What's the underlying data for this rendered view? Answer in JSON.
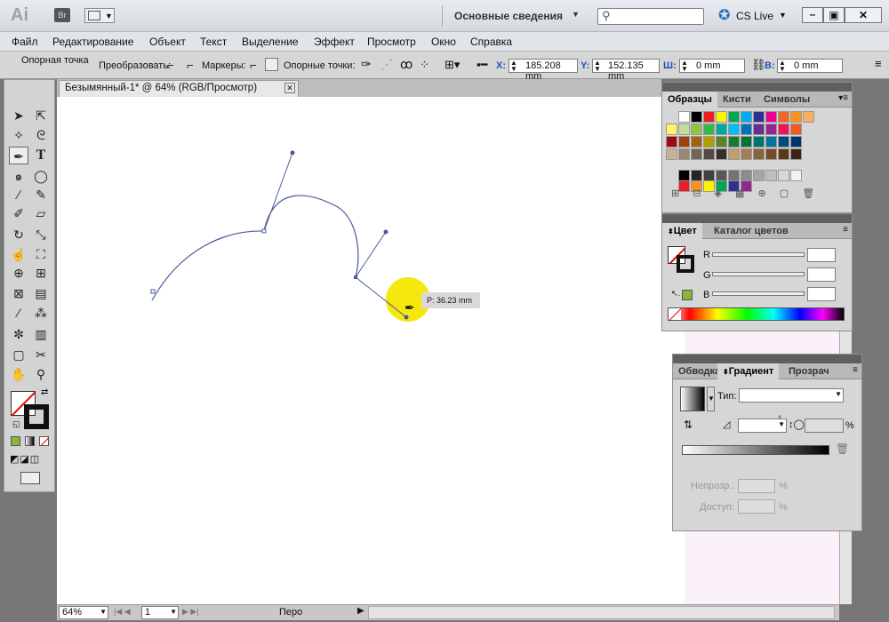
{
  "app": {
    "logo": "Ai",
    "bridge": "Br",
    "workspace": "Основные сведения",
    "cslive": "CS Live"
  },
  "menu": [
    "Файл",
    "Редактирование",
    "Объект",
    "Текст",
    "Выделение",
    "Эффект",
    "Просмотр",
    "Окно",
    "Справка"
  ],
  "control": {
    "anchor_label": "Опорная точка",
    "convert_label": "Преобразовать:",
    "handles_label": "Маркеры:",
    "anchors_label": "Опорные точки:",
    "x_label": "X:",
    "x_value": "185.208 mm",
    "y_label": "Y:",
    "y_value": "152.135 mm",
    "w_label": "Ш:",
    "w_value": "0 mm",
    "h_label": "В:",
    "h_value": "0 mm"
  },
  "document": {
    "tab_title": "Безымянный-1* @ 64% (RGB/Просмотр)"
  },
  "tooltip": "P: 36.23 mm",
  "status": {
    "zoom": "64%",
    "page": "1",
    "tool": "Перо"
  },
  "swatches_panel": {
    "tabs": [
      "Образцы",
      "Кисти",
      "Символы"
    ]
  },
  "color_panel": {
    "tabs": [
      "Цвет",
      "Каталог цветов"
    ],
    "labels": [
      "R",
      "G",
      "B"
    ]
  },
  "gradient_panel": {
    "tabs": [
      "Обводка",
      "Градиент",
      "Прозрач"
    ],
    "type_label": "Тип:",
    "opacity_label": "Непрозр.:",
    "location_label": "Доступ:",
    "percent": "%"
  },
  "colors": {
    "accent_fill": "#8cb43c",
    "highlight": "#f5e600",
    "path": "#4a5a9a"
  },
  "swatch_rows": [
    [
      "#ffffff",
      "#000000",
      "#ed1c24",
      "#fff200",
      "#00a651",
      "#00aeef",
      "#2e3192",
      "#ec008c",
      "#f26522",
      "#f7941d",
      "#fbaf5d"
    ],
    [
      "#fff568",
      "#c4df9b",
      "#8dc63f",
      "#39b54a",
      "#00a99d",
      "#00bff3",
      "#0072bc",
      "#662d91",
      "#92278f",
      "#ed145b",
      "#f15a24"
    ],
    [
      "#9e0b0f",
      "#a0410d",
      "#a3620a",
      "#aba000",
      "#598527",
      "#1a7b30",
      "#007236",
      "#00746b",
      "#0076a3",
      "#004a80",
      "#003471"
    ],
    [
      "#c7b299",
      "#998675",
      "#736357",
      "#534741",
      "#37302a",
      "#c69c6d",
      "#a67c52",
      "#8c6239",
      "#754c24",
      "#603913",
      "#3c2415"
    ]
  ],
  "gray_swatches": [
    "#000000",
    "#262626",
    "#404040",
    "#595959",
    "#737373",
    "#8c8c8c",
    "#a6a6a6",
    "#bfbfbf",
    "#d9d9d9",
    "#f2f2f2"
  ],
  "bottom_swatches": [
    "#ed1c24",
    "#f7941d",
    "#fff200",
    "#00a651",
    "#2e3192",
    "#92278f"
  ]
}
